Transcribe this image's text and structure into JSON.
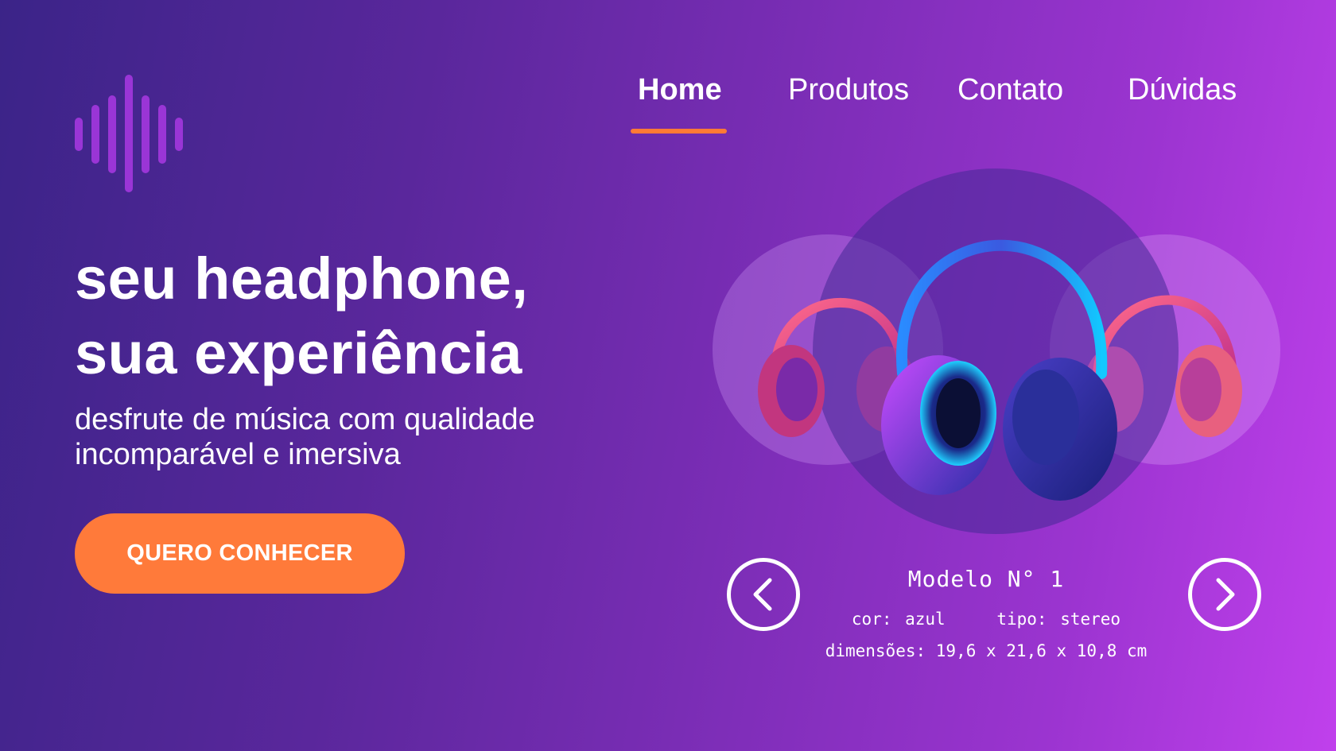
{
  "logo": {
    "icon": "soundwave-icon",
    "color": "#9a35d6"
  },
  "nav": {
    "items": [
      {
        "label": "Home",
        "active": true
      },
      {
        "label": "Produtos",
        "active": false
      },
      {
        "label": "Contato",
        "active": false
      },
      {
        "label": "Dúvidas",
        "active": false
      }
    ],
    "underline_color": "#ff7a35"
  },
  "hero": {
    "headline_line1": "seu headphone,",
    "headline_line2": "sua experiência",
    "subtitle_line1": "desfrute de música com qualidade",
    "subtitle_line2": "incomparável e imersiva",
    "cta_label": "QUERO CONHECER",
    "cta_color": "#ff7a3a"
  },
  "carousel": {
    "prev_icon": "chevron-left-icon",
    "next_icon": "chevron-right-icon",
    "model_name": "Modelo N° 1",
    "color_spec": "cor: azul",
    "type_spec": "tipo: stereo",
    "dimensions": "dimensões: 19,6 x 21,6 x 10,8 cm"
  },
  "colors": {
    "bg_start": "#3b2488",
    "bg_end": "#c040ec",
    "accent": "#ff7a35"
  }
}
